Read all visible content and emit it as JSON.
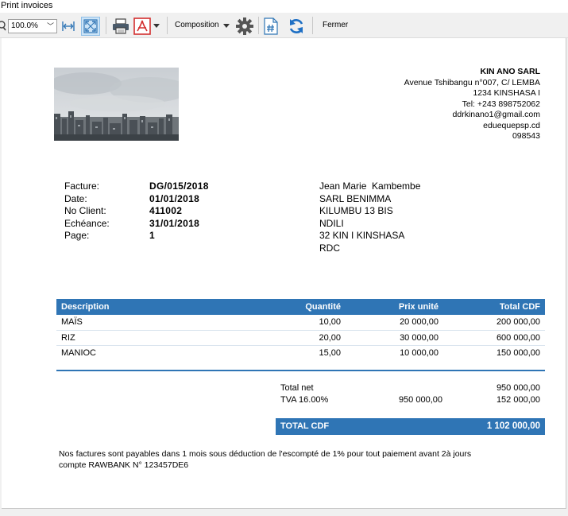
{
  "window": {
    "title": "Print invoices"
  },
  "toolbar": {
    "zoom_value": "100.0%",
    "composition_label": "Composition",
    "close_label": "Fermer"
  },
  "company": {
    "name": "KIN ANO SARL",
    "address": "Avenue Tshibangu n°007, C/ LEMBA",
    "city": "1234 KINSHASA I",
    "tel": "Tel: +243 898752062",
    "email": "ddrkinano1@gmail.com",
    "web": "eduequepsp.cd",
    "code": "098543"
  },
  "invoice": {
    "labels": {
      "invoice": "Facture:",
      "date": "Date:",
      "client_no": "No Client:",
      "due": "Echéance:",
      "page": "Page:"
    },
    "number": "DG/015/2018",
    "date": "01/01/2018",
    "client_no": "411002",
    "due": "31/01/2018",
    "page": "1"
  },
  "client": {
    "name": "Jean Marie  Kambembe",
    "company": "SARL BENIMMA",
    "street": "KILUMBU 13 BIS",
    "district": "NDILI",
    "city": "32 KIN I KINSHASA",
    "country": "RDC"
  },
  "table": {
    "headers": [
      "Description",
      "Quantité",
      "Prix unité",
      "Total CDF"
    ],
    "rows": [
      [
        "MAÏS",
        "10,00",
        "20 000,00",
        "200 000,00"
      ],
      [
        "RIZ",
        "20,00",
        "30 000,00",
        "600 000,00"
      ],
      [
        "MANIOC",
        "15,00",
        "10 000,00",
        "150 000,00"
      ]
    ]
  },
  "totals": {
    "net_label": "Total net",
    "net_value": "950 000,00",
    "tva_label": "TVA 16.00%",
    "tva_base": "950 000,00",
    "tva_value": "152 000,00",
    "grand_label": "TOTAL CDF",
    "grand_value": "1 102 000,00"
  },
  "footer": {
    "line1": "Nos factures sont payables dans 1 mois sous déduction de l'escompté de 1% pour tout paiement avant 2à jours",
    "line2": "compte RAWBANK N° 123457DE6"
  },
  "colors": {
    "accent": "#2f75b5",
    "pdf_red": "#d32f2f"
  },
  "icons": [
    "search-icon",
    "fit-width-icon",
    "fit-page-icon",
    "printer-icon",
    "pdf-icon",
    "dropdown-arrow-icon",
    "gear-icon",
    "hash-document-icon",
    "refresh-icon"
  ]
}
